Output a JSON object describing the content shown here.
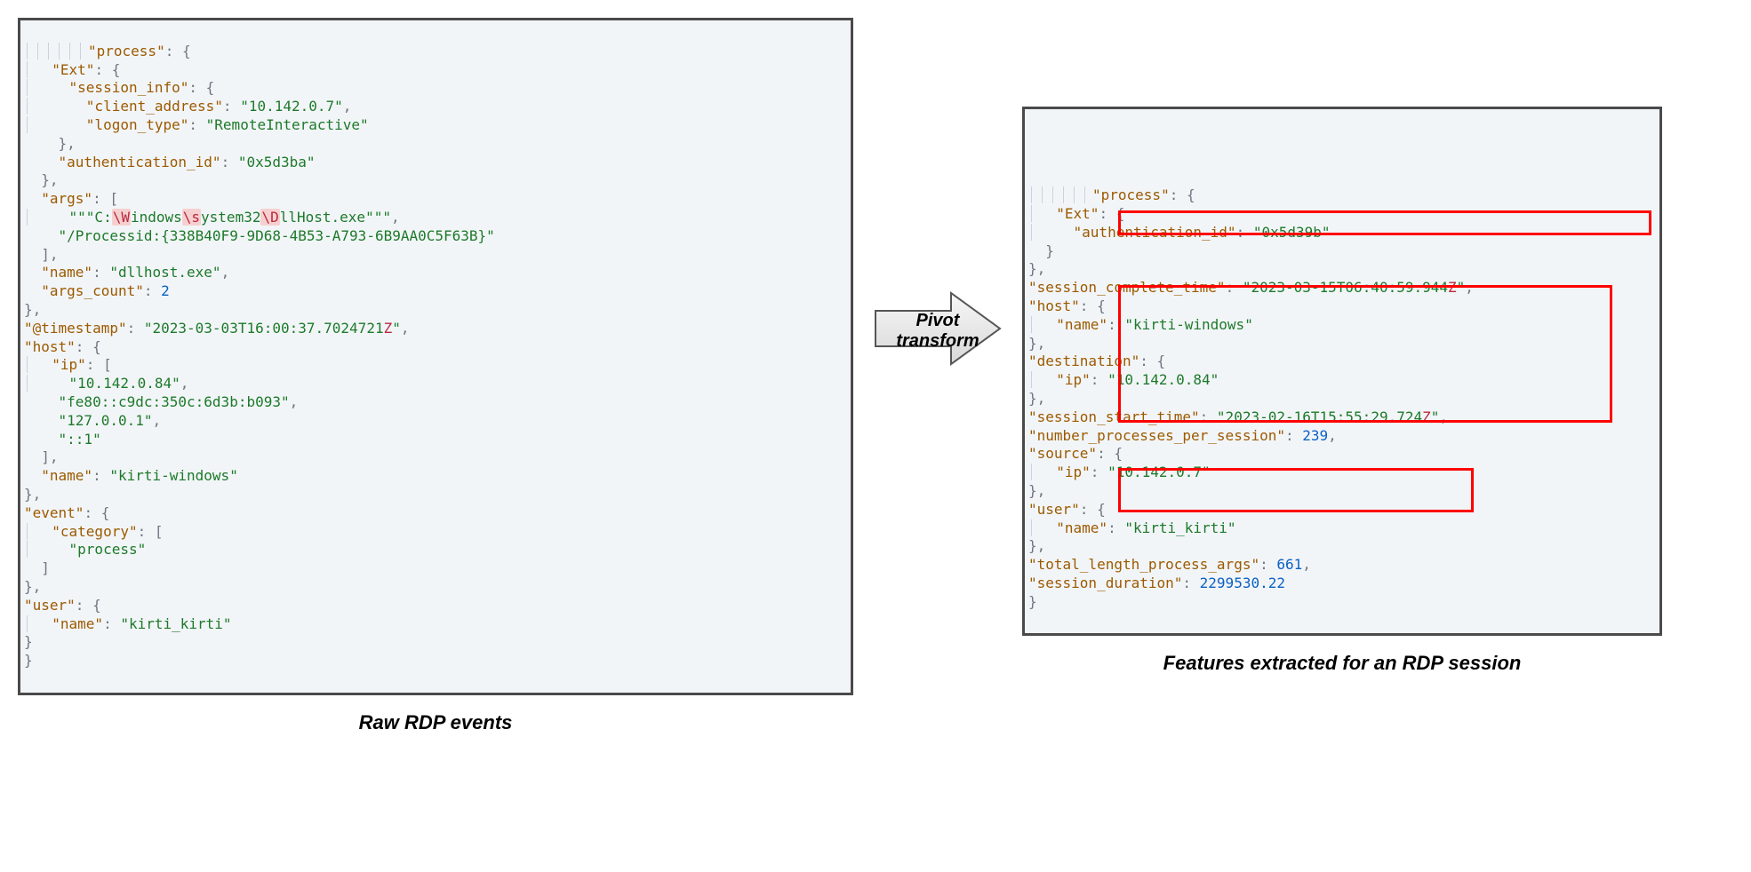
{
  "left": {
    "caption": "Raw RDP events",
    "json": {
      "process": {
        "Ext": {
          "session_info": {
            "client_address": "10.142.0.7",
            "logon_type": "RemoteInteractive"
          },
          "authentication_id": "0x5d3ba"
        },
        "args": [
          "\"\"\"C:\\Windows\\system32\\DllHost.exe\"\"\"",
          "/Processid:{338B40F9-9D68-4B53-A793-6B9AA0C5F63B}"
        ],
        "name": "dllhost.exe",
        "args_count": 2
      },
      "@timestamp": "2023-03-03T16:00:37.7024721Z",
      "host": {
        "ip": [
          "10.142.0.84",
          "fe80::c9dc:350c:6d3b:b093",
          "127.0.0.1",
          "::1"
        ],
        "name": "kirti-windows"
      },
      "event": {
        "category": [
          "process"
        ]
      },
      "user": {
        "name": "kirti_kirti"
      }
    }
  },
  "arrow": {
    "label": "Pivot\ntransform"
  },
  "right": {
    "caption": "Features extracted for an RDP session",
    "json": {
      "process": {
        "Ext": {
          "authentication_id": "0x5d39b"
        }
      },
      "session_complete_time": "2023-03-15T06:40:59.944Z",
      "host": {
        "name": "kirti-windows"
      },
      "destination": {
        "ip": "10.142.0.84"
      },
      "session_start_time": "2023-02-16T15:55:29.724Z",
      "number_processes_per_session": 239,
      "source": {
        "ip": "10.142.0.7"
      },
      "user": {
        "name": "kirti_kirti"
      },
      "total_length_process_args": 661,
      "session_duration": 2299530.22
    }
  }
}
